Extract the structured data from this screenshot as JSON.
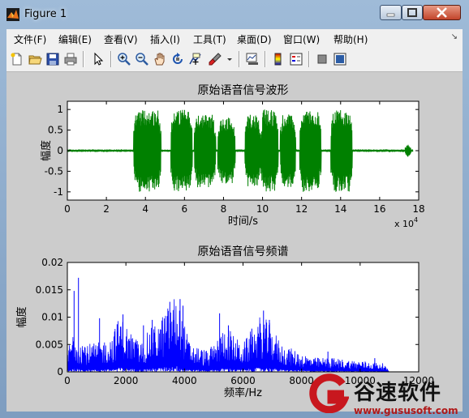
{
  "window": {
    "title": "Figure 1"
  },
  "menu": [
    "文件(F)",
    "编辑(E)",
    "查看(V)",
    "插入(I)",
    "工具(T)",
    "桌面(D)",
    "窗口(W)",
    "帮助(H)"
  ],
  "toolbar": [
    "new-figure-icon",
    "open-icon",
    "save-icon",
    "print-icon",
    "pointer-icon",
    "zoom-in-icon",
    "zoom-out-icon",
    "pan-icon",
    "rotate-icon",
    "data-cursor-icon",
    "brush-icon",
    "link-icon",
    "colorbar-icon",
    "legend-icon",
    "hide-plot-tools-icon",
    "show-plot-tools-icon"
  ],
  "chart_data": [
    {
      "type": "line",
      "title": "原始语音信号波形",
      "xlabel": "时间/s",
      "ylabel": "幅度",
      "x_multiplier": "x 10^4",
      "xlim": [
        0,
        18
      ],
      "ylim": [
        -1.2,
        1.2
      ],
      "x_ticks": [
        0,
        2,
        4,
        6,
        8,
        10,
        12,
        14,
        16,
        18
      ],
      "y_ticks": [
        1,
        0.5,
        0,
        -0.5,
        -1
      ],
      "color": "#008000",
      "bursts": [
        {
          "start": 3.4,
          "end": 4.8,
          "amp": 1.0
        },
        {
          "start": 5.3,
          "end": 6.4,
          "amp": 1.0
        },
        {
          "start": 6.5,
          "end": 7.6,
          "amp": 0.9
        },
        {
          "start": 7.7,
          "end": 8.6,
          "amp": 0.8
        },
        {
          "start": 9.1,
          "end": 9.9,
          "amp": 0.9
        },
        {
          "start": 9.9,
          "end": 10.8,
          "amp": 1.0
        },
        {
          "start": 10.9,
          "end": 11.7,
          "amp": 0.9
        },
        {
          "start": 11.9,
          "end": 13.0,
          "amp": 1.0
        },
        {
          "start": 13.5,
          "end": 14.6,
          "amp": 1.0
        },
        {
          "start": 17.3,
          "end": 17.6,
          "amp": 0.15
        }
      ]
    },
    {
      "type": "line",
      "title": "原始语音信号频谱",
      "xlabel": "频率/Hz",
      "ylabel": "幅度",
      "xlim": [
        0,
        12000
      ],
      "ylim": [
        0,
        0.02
      ],
      "x_ticks": [
        0,
        2000,
        4000,
        6000,
        8000,
        10000,
        12000
      ],
      "y_ticks": [
        "0.02",
        "0.015",
        "0.01",
        "0.005",
        "0"
      ],
      "color": "#0000ff",
      "envelope": [
        [
          0,
          0.003
        ],
        [
          200,
          0.006
        ],
        [
          400,
          0.005
        ],
        [
          700,
          0.004
        ],
        [
          1000,
          0.004
        ],
        [
          1500,
          0.005
        ],
        [
          1800,
          0.008
        ],
        [
          2100,
          0.006
        ],
        [
          2500,
          0.004
        ],
        [
          2800,
          0.006
        ],
        [
          3100,
          0.007
        ],
        [
          3400,
          0.009
        ],
        [
          3700,
          0.011
        ],
        [
          3900,
          0.008
        ],
        [
          4200,
          0.004
        ],
        [
          4800,
          0.003
        ],
        [
          5200,
          0.005
        ],
        [
          5400,
          0.007
        ],
        [
          5700,
          0.005
        ],
        [
          6000,
          0.004
        ],
        [
          6300,
          0.006
        ],
        [
          6600,
          0.008
        ],
        [
          6900,
          0.007
        ],
        [
          7300,
          0.004
        ],
        [
          7800,
          0.003
        ],
        [
          8400,
          0.002
        ],
        [
          9000,
          0.002
        ],
        [
          9600,
          0.0017
        ],
        [
          10200,
          0.0015
        ],
        [
          10800,
          0.0012
        ],
        [
          11000,
          0.0
        ],
        [
          12000,
          0.0
        ]
      ],
      "peaks": [
        [
          230,
          0.0148
        ],
        [
          380,
          0.0172
        ],
        [
          1100,
          0.0098
        ],
        [
          1700,
          0.0087
        ],
        [
          1900,
          0.0105
        ],
        [
          2600,
          0.0085
        ],
        [
          2900,
          0.0095
        ],
        [
          3500,
          0.0128
        ],
        [
          3850,
          0.0133
        ],
        [
          3950,
          0.0121
        ],
        [
          5200,
          0.0107
        ],
        [
          5500,
          0.0085
        ],
        [
          6300,
          0.0079
        ],
        [
          6700,
          0.0112
        ],
        [
          6900,
          0.0095
        ],
        [
          8900,
          0.0037
        ],
        [
          10500,
          0.0025
        ]
      ]
    }
  ],
  "watermark": {
    "name": "谷速软件",
    "url": "www.gususoft.com"
  }
}
